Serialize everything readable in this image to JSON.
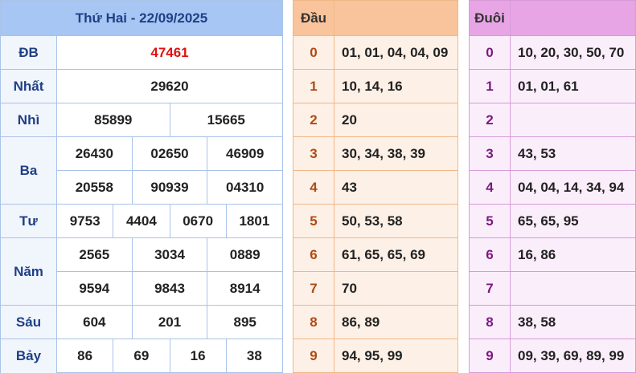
{
  "results": {
    "header": "Thứ Hai - 22/09/2025",
    "rows": [
      {
        "label": "ĐB",
        "numbers": [
          "47461"
        ]
      },
      {
        "label": "Nhất",
        "numbers": [
          "29620"
        ]
      },
      {
        "label": "Nhì",
        "numbers": [
          "85899",
          "15665"
        ]
      },
      {
        "label": "Ba",
        "numbers": [
          "26430",
          "02650",
          "46909",
          "20558",
          "90939",
          "04310"
        ]
      },
      {
        "label": "Tư",
        "numbers": [
          "9753",
          "4404",
          "0670",
          "1801"
        ]
      },
      {
        "label": "Năm",
        "numbers": [
          "2565",
          "3034",
          "0889",
          "9594",
          "9843",
          "8914"
        ]
      },
      {
        "label": "Sáu",
        "numbers": [
          "604",
          "201",
          "895"
        ]
      },
      {
        "label": "Bảy",
        "numbers": [
          "86",
          "69",
          "16",
          "38"
        ]
      }
    ]
  },
  "dau": {
    "header": "Đầu",
    "rows": [
      {
        "key": "0",
        "value": "01, 01, 04, 04, 09"
      },
      {
        "key": "1",
        "value": "10, 14, 16"
      },
      {
        "key": "2",
        "value": "20"
      },
      {
        "key": "3",
        "value": "30, 34, 38, 39"
      },
      {
        "key": "4",
        "value": "43"
      },
      {
        "key": "5",
        "value": "50, 53, 58"
      },
      {
        "key": "6",
        "value": "61, 65, 65, 69"
      },
      {
        "key": "7",
        "value": "70"
      },
      {
        "key": "8",
        "value": "86, 89"
      },
      {
        "key": "9",
        "value": "94, 95, 99"
      }
    ]
  },
  "duoi": {
    "header": "Đuôi",
    "rows": [
      {
        "key": "0",
        "value": "10, 20, 30, 50, 70"
      },
      {
        "key": "1",
        "value": "01, 01, 61"
      },
      {
        "key": "2",
        "value": ""
      },
      {
        "key": "3",
        "value": "43, 53"
      },
      {
        "key": "4",
        "value": "04, 04, 14, 34, 94"
      },
      {
        "key": "5",
        "value": "65, 65, 95"
      },
      {
        "key": "6",
        "value": "16, 86"
      },
      {
        "key": "7",
        "value": ""
      },
      {
        "key": "8",
        "value": "38, 58"
      },
      {
        "key": "9",
        "value": "09, 39, 69, 89, 99"
      }
    ]
  }
}
